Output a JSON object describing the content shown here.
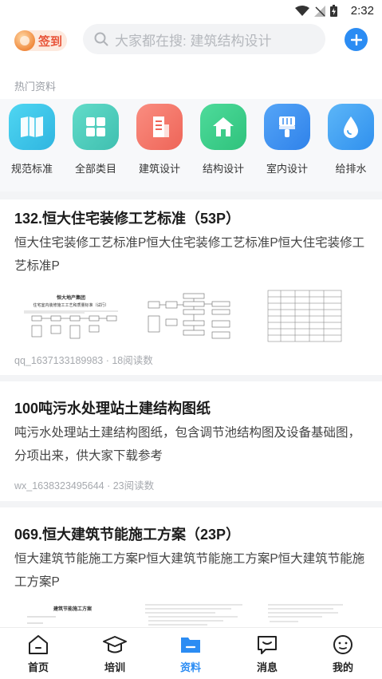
{
  "status_bar": {
    "time": "2:32"
  },
  "header": {
    "signin_label": "签到",
    "search_placeholder": "大家都在搜: 建筑结构设计"
  },
  "hot": {
    "title": "热门资料",
    "categories": [
      {
        "label": "规范标准",
        "icon": "book-icon",
        "color": "#3cc6e8"
      },
      {
        "label": "全部类目",
        "icon": "grid-icon",
        "color": "#49cfbf"
      },
      {
        "label": "建筑设计",
        "icon": "building-icon",
        "color": "#f0766a"
      },
      {
        "label": "结构设计",
        "icon": "house-icon",
        "color": "#3dcc8a"
      },
      {
        "label": "室内设计",
        "icon": "brush-icon",
        "color": "#3a8ff0"
      },
      {
        "label": "给排水",
        "icon": "water-drop-icon",
        "color": "#3aa0f0"
      }
    ]
  },
  "articles": [
    {
      "title": "132.恒大住宅装修工艺标准（53P）",
      "desc": "恒大住宅装修工艺标准P恒大住宅装修工艺标准P恒大住宅装修工艺标准P",
      "meta": "qq_1637133189983 · 18阅读数",
      "thumb_title": "恒大地产集团",
      "thumb_subtitle": "住宅室内装修施工工艺和质量标准（试行）"
    },
    {
      "title": "100吨污水处理站土建结构图纸",
      "desc": "吨污水处理站土建结构图纸，包含调节池结构图及设备基础图，分项出来，供大家下载参考",
      "meta": "wx_1638323495644 · 23阅读数"
    },
    {
      "title": "069.恒大建筑节能施工方案（23P）",
      "desc": "恒大建筑节能施工方案P恒大建筑节能施工方案P恒大建筑节能施工方案P",
      "thumb_title": "建筑节能施工方案"
    }
  ],
  "tabbar": {
    "tabs": [
      {
        "label": "首页",
        "icon": "home-icon"
      },
      {
        "label": "培训",
        "icon": "graduation-cap-icon"
      },
      {
        "label": "资料",
        "icon": "folder-icon",
        "active": true
      },
      {
        "label": "消息",
        "icon": "message-icon"
      },
      {
        "label": "我的",
        "icon": "profile-icon"
      }
    ]
  },
  "colors": {
    "accent": "#2b8cf3",
    "signin": "#e8553a"
  }
}
